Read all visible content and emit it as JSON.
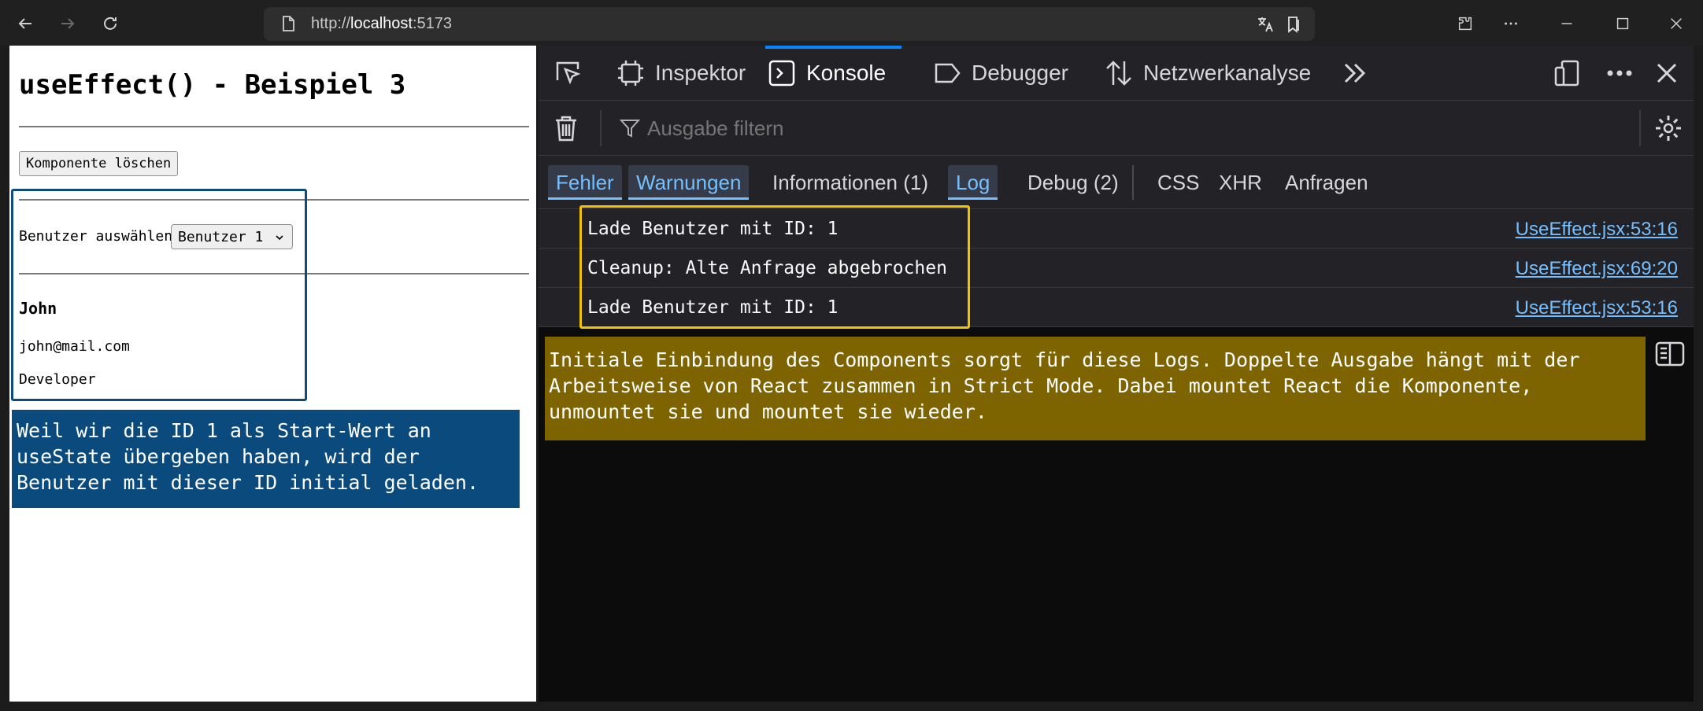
{
  "browser": {
    "url_scheme": "http://",
    "url_host": "localhost",
    "url_port": ":5173"
  },
  "page": {
    "heading": "useEffect() - Beispiel 3",
    "delete_button": "Komponente löschen",
    "select_label": "Benutzer auswählen",
    "select_value": "Benutzer 1",
    "user": {
      "name": "John",
      "email": "john@mail.com",
      "role": "Developer"
    },
    "note": "Weil wir die ID 1 als Start-Wert an useState übergeben haben, wird der Benutzer mit dieser ID initial geladen."
  },
  "devtools": {
    "tabs": {
      "inspector": "Inspektor",
      "console": "Konsole",
      "debugger": "Debugger",
      "network": "Netzwerkanalyse"
    },
    "filter_placeholder": "Ausgabe filtern",
    "levels": {
      "errors": "Fehler",
      "warnings": "Warnungen",
      "info": "Informationen (1)",
      "log": "Log",
      "debug": "Debug (2)",
      "css": "CSS",
      "xhr": "XHR",
      "requests": "Anfragen"
    },
    "logs": [
      {
        "message": "Lade Benutzer mit ID: 1",
        "source": "UseEffect.jsx:53:16"
      },
      {
        "message": "Cleanup: Alte Anfrage abgebrochen",
        "source": "UseEffect.jsx:69:20"
      },
      {
        "message": "Lade Benutzer mit ID: 1",
        "source": "UseEffect.jsx:53:16"
      }
    ],
    "note": "Initiale Einbindung des Components sorgt für diese Logs. Doppelte Ausgabe hängt mit der Arbeitsweise von React zusammen in Strict Mode. Dabei mountet React die Komponente, unmountet sie und mountet sie wieder."
  },
  "colors": {
    "accent_blue": "#0a84ff",
    "link_blue": "#75bfff",
    "annotation_blue": "#0b4a7d",
    "annotation_yellow": "#7d6400",
    "highlight_yellow": "#f2c400"
  }
}
